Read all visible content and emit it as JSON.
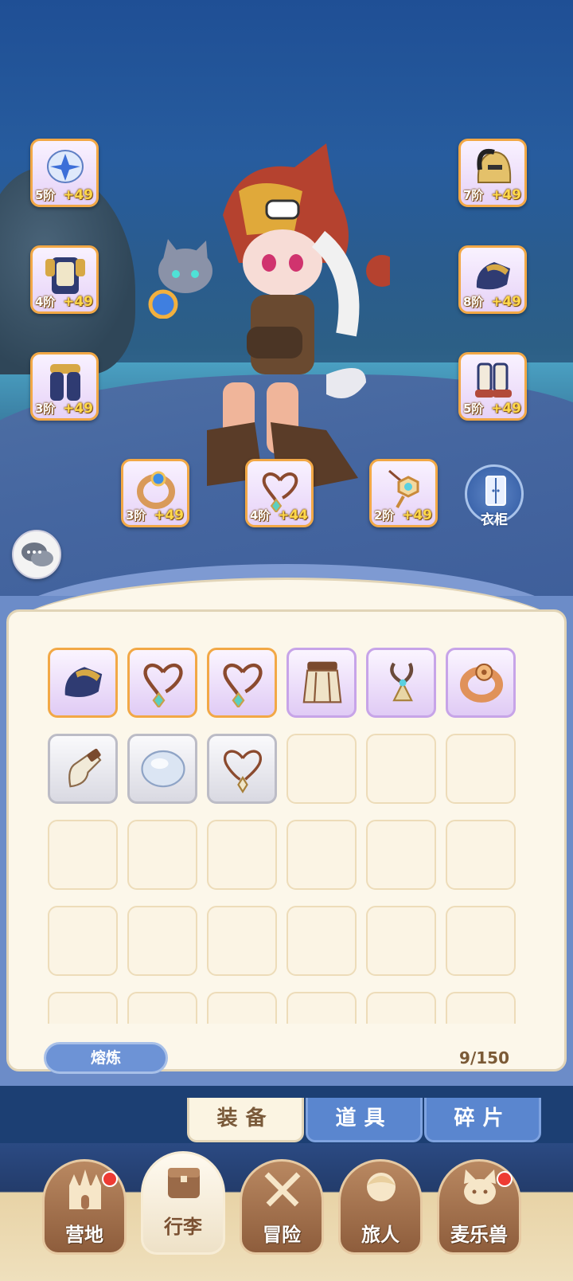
{
  "equipment_slots": [
    {
      "id": "slot-head-ornament",
      "tier": "5阶",
      "plus": "+49",
      "icon": "star-crystal-icon"
    },
    {
      "id": "slot-chest",
      "tier": "4阶",
      "plus": "+49",
      "icon": "armor-chest-icon"
    },
    {
      "id": "slot-legs",
      "tier": "3阶",
      "plus": "+49",
      "icon": "armor-legs-icon"
    },
    {
      "id": "slot-helmet",
      "tier": "7阶",
      "plus": "+49",
      "icon": "helmet-icon"
    },
    {
      "id": "slot-gloves",
      "tier": "8阶",
      "plus": "+49",
      "icon": "gauntlet-icon"
    },
    {
      "id": "slot-boots",
      "tier": "5阶",
      "plus": "+49",
      "icon": "boots-icon"
    },
    {
      "id": "slot-ring",
      "tier": "3阶",
      "plus": "+49",
      "icon": "ring-icon"
    },
    {
      "id": "slot-necklace",
      "tier": "4阶",
      "plus": "+44",
      "icon": "necklace-icon"
    },
    {
      "id": "slot-amulet",
      "tier": "2阶",
      "plus": "+49",
      "icon": "amulet-icon"
    }
  ],
  "wardrobe": {
    "label": "衣柜",
    "icon": "wardrobe-icon"
  },
  "chat": {
    "icon": "chat-bubble-icon"
  },
  "inventory": {
    "items": [
      {
        "rarity": "orange",
        "icon": "gauntlet-icon"
      },
      {
        "rarity": "orange",
        "icon": "necklace-icon"
      },
      {
        "rarity": "orange",
        "icon": "necklace-icon"
      },
      {
        "rarity": "purple",
        "icon": "skirt-icon"
      },
      {
        "rarity": "purple",
        "icon": "pendant-icon"
      },
      {
        "rarity": "purple",
        "icon": "ring-icon"
      },
      {
        "rarity": "gray",
        "icon": "glove-icon"
      },
      {
        "rarity": "gray",
        "icon": "shell-icon"
      },
      {
        "rarity": "gray",
        "icon": "necklace-icon"
      }
    ],
    "smelt_label": "熔炼",
    "capacity": "9/150"
  },
  "tabs": [
    {
      "label": "装备",
      "active": true
    },
    {
      "label": "道具",
      "active": false
    },
    {
      "label": "碎片",
      "active": false
    }
  ],
  "nav": [
    {
      "label": "营地",
      "icon": "castle-icon",
      "badge": true,
      "active": false
    },
    {
      "label": "行李",
      "icon": "backpack-icon",
      "badge": false,
      "active": true
    },
    {
      "label": "冒险",
      "icon": "crossed-swords-icon",
      "badge": false,
      "active": false
    },
    {
      "label": "旅人",
      "icon": "traveler-icon",
      "badge": false,
      "active": false
    },
    {
      "label": "麦乐兽",
      "icon": "pet-icon",
      "badge": true,
      "active": false
    }
  ],
  "colors": {
    "orange_frame": "#f2a846",
    "purple_frame": "#c7a4e8",
    "gray_frame": "#bcbcc6",
    "badge": "#ee3b33"
  }
}
